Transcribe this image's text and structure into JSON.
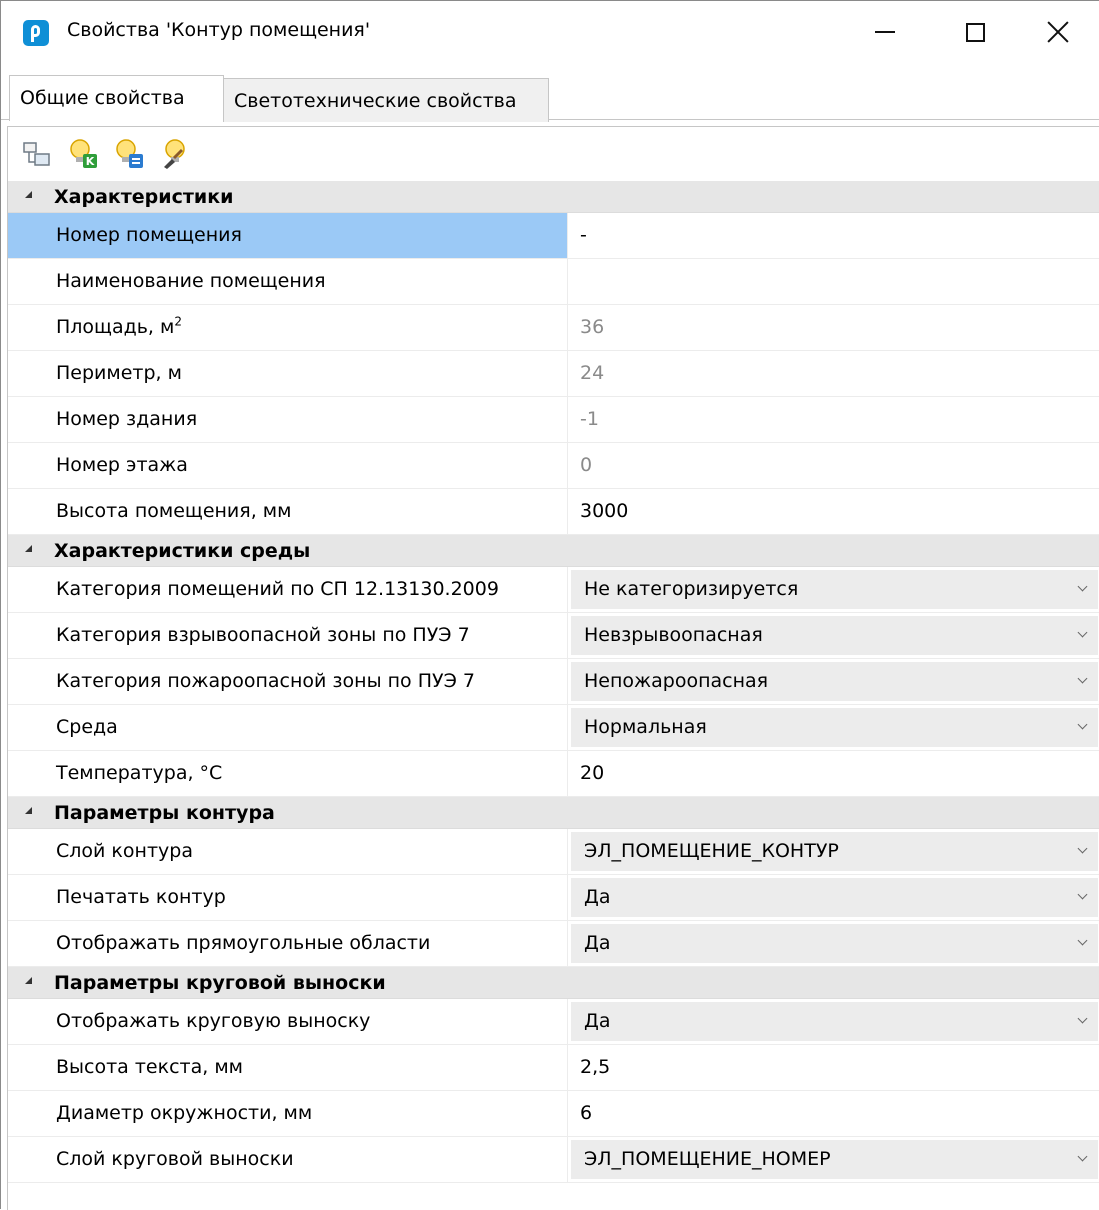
{
  "window": {
    "title": "Свойства 'Контур помещения'",
    "icon": "app-logo-icon"
  },
  "tabs": [
    {
      "label": "Общие свойства",
      "active": true
    },
    {
      "label": "Светотехнические свойства",
      "active": false
    }
  ],
  "toolbar": {
    "icons": [
      "copy-properties-icon",
      "lamp-k-icon",
      "lamp-table-icon",
      "lamp-brush-icon"
    ]
  },
  "sections": [
    {
      "title": "Характеристики",
      "rows": [
        {
          "label": "Номер помещения",
          "value": "-",
          "kind": "text",
          "selected": true
        },
        {
          "label": "Наименование помещения",
          "value": "",
          "kind": "text"
        },
        {
          "label": "Площадь, м",
          "label_sup": "2",
          "value": "36",
          "kind": "readonly"
        },
        {
          "label": "Периметр, м",
          "value": "24",
          "kind": "readonly"
        },
        {
          "label": "Номер здания",
          "value": "-1",
          "kind": "readonly"
        },
        {
          "label": "Номер этажа",
          "value": "0",
          "kind": "readonly"
        },
        {
          "label": "Высота помещения, мм",
          "value": "3000",
          "kind": "text"
        }
      ]
    },
    {
      "title": "Характеристики среды",
      "rows": [
        {
          "label": "Категория помещений по СП 12.13130.2009",
          "value": "Не категоризируется",
          "kind": "combo"
        },
        {
          "label": "Категория взрывоопасной зоны по ПУЭ 7",
          "value": "Невзрывоопасная",
          "kind": "combo"
        },
        {
          "label": "Категория пожароопасной зоны по ПУЭ 7",
          "value": "Непожароопасная",
          "kind": "combo"
        },
        {
          "label": "Среда",
          "value": "Нормальная",
          "kind": "combo"
        },
        {
          "label": "Температура, °C",
          "value": "20",
          "kind": "text"
        }
      ]
    },
    {
      "title": "Параметры контура",
      "rows": [
        {
          "label": "Слой контура",
          "value": "ЭЛ_ПОМЕЩЕНИЕ_КОНТУР",
          "kind": "combo"
        },
        {
          "label": "Печатать контур",
          "value": "Да",
          "kind": "combo"
        },
        {
          "label": "Отображать прямоугольные области",
          "value": "Да",
          "kind": "combo"
        }
      ]
    },
    {
      "title": "Параметры круговой выноски",
      "rows": [
        {
          "label": "Отображать круговую выноску",
          "value": "Да",
          "kind": "combo"
        },
        {
          "label": "Высота текста, мм",
          "value": "2,5",
          "kind": "text"
        },
        {
          "label": "Диаметр окружности, мм",
          "value": "6",
          "kind": "text"
        },
        {
          "label": "Слой круговой выноски",
          "value": "ЭЛ_ПОМЕЩЕНИЕ_НОМЕР",
          "kind": "combo"
        }
      ]
    }
  ]
}
